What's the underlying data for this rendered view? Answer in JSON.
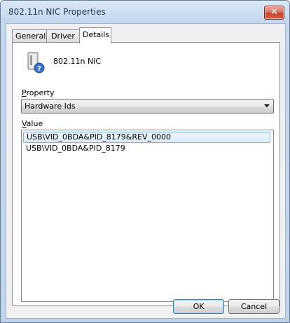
{
  "window": {
    "title": "802.11n NIC Properties",
    "close_glyph": "✕"
  },
  "tabs": [
    {
      "label": "General"
    },
    {
      "label": "Driver"
    },
    {
      "label": "Details"
    }
  ],
  "details": {
    "device_name": "802.11n NIC",
    "device_icon": "network-adapter-question-icon",
    "property_label_accel": "P",
    "property_label_rest": "roperty",
    "property_value": "Hardware Ids",
    "value_label_accel": "V",
    "value_label_rest": "alue",
    "values": [
      "USB\\VID_0BDA&PID_8179&REV_0000",
      "USB\\VID_0BDA&PID_8179"
    ]
  },
  "buttons": {
    "ok": "OK",
    "cancel": "Cancel"
  },
  "colors": {
    "selection_border": "#84acdd",
    "close_button": "#c4412b"
  }
}
